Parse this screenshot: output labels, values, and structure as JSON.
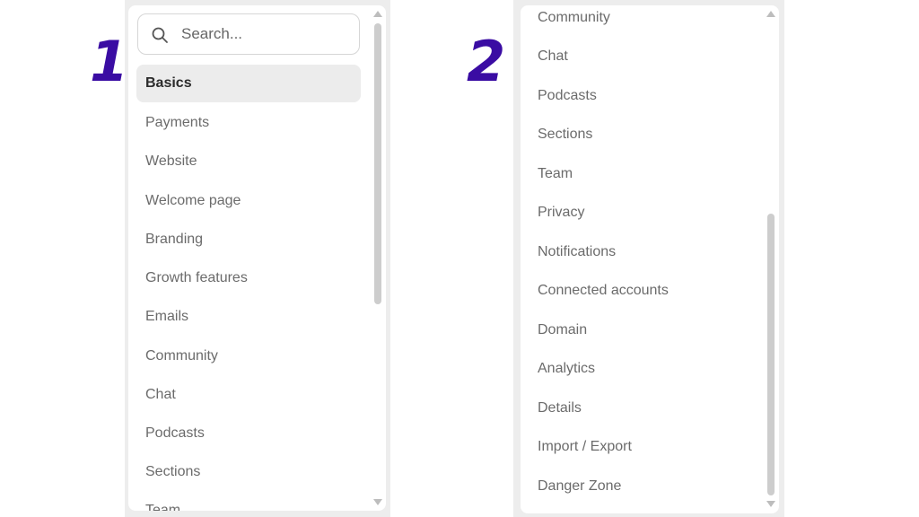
{
  "step_labels": [
    "1",
    "2"
  ],
  "panel1": {
    "search": {
      "placeholder": "Search..."
    },
    "items": [
      {
        "label": "Basics",
        "active": true
      },
      {
        "label": "Payments"
      },
      {
        "label": "Website"
      },
      {
        "label": "Welcome page"
      },
      {
        "label": "Branding"
      },
      {
        "label": "Growth features"
      },
      {
        "label": "Emails"
      },
      {
        "label": "Community"
      },
      {
        "label": "Chat"
      },
      {
        "label": "Podcasts"
      },
      {
        "label": "Sections"
      },
      {
        "label": "Team"
      }
    ]
  },
  "panel2": {
    "items": [
      {
        "label": "Community"
      },
      {
        "label": "Chat"
      },
      {
        "label": "Podcasts"
      },
      {
        "label": "Sections"
      },
      {
        "label": "Team"
      },
      {
        "label": "Privacy"
      },
      {
        "label": "Notifications"
      },
      {
        "label": "Connected accounts"
      },
      {
        "label": "Domain"
      },
      {
        "label": "Analytics"
      },
      {
        "label": "Details"
      },
      {
        "label": "Import / Export"
      },
      {
        "label": "Danger Zone"
      }
    ]
  },
  "colors": {
    "step_number": "#3a0ca3",
    "active_bg": "#ececec",
    "frame_bg": "#ededed"
  }
}
